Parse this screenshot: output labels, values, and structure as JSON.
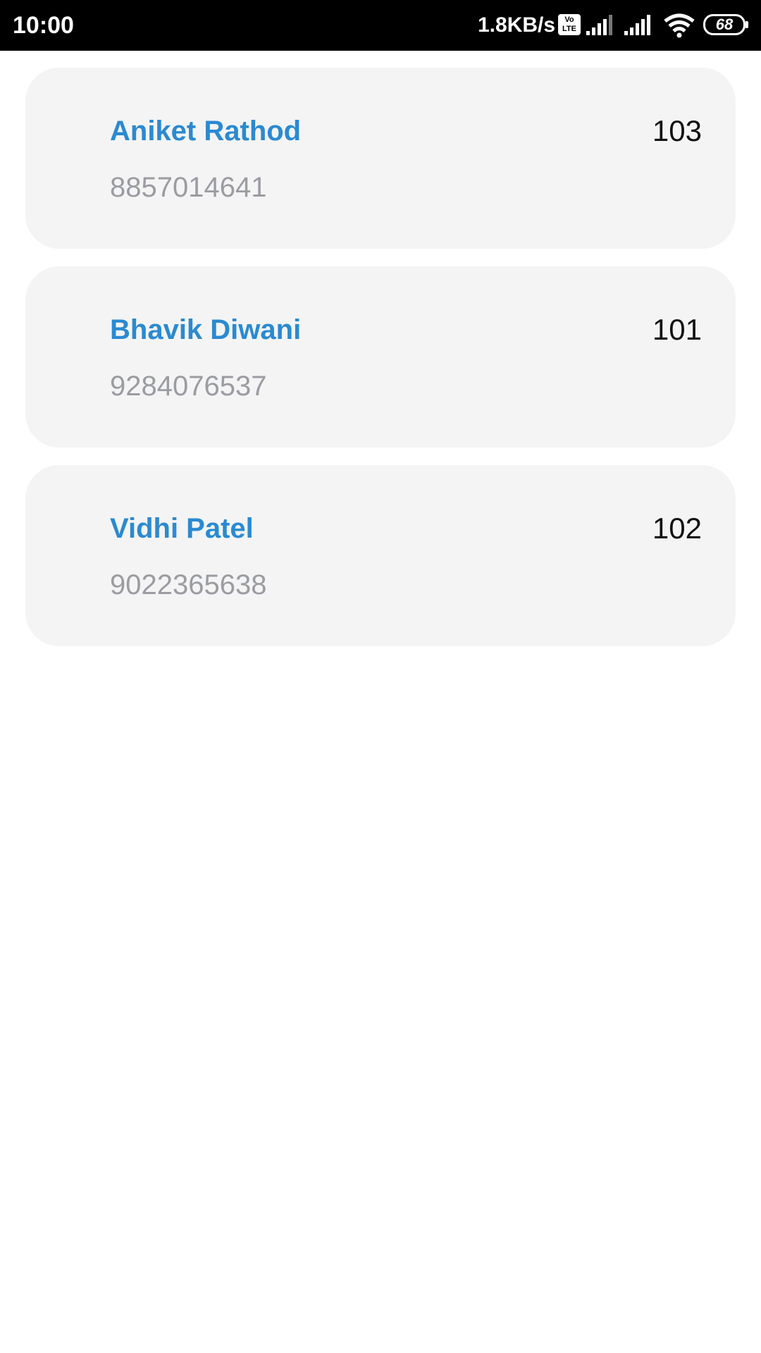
{
  "status_bar": {
    "time": "10:00",
    "network_speed": "1.8KB/s",
    "volte_label": "Vo LTE",
    "battery": "68"
  },
  "contacts": [
    {
      "name": "Aniket Rathod",
      "phone": "8857014641",
      "number": "103"
    },
    {
      "name": "Bhavik Diwani",
      "phone": "9284076537",
      "number": "101"
    },
    {
      "name": "Vidhi Patel",
      "phone": "9022365638",
      "number": "102"
    }
  ],
  "colors": {
    "name_accent": "#2a8ad1",
    "phone_gray": "#9b9ca1",
    "card_background": "#f4f4f5",
    "status_bar": "#000000"
  },
  "icons": [
    "volte-icon",
    "signal-icon",
    "signal-icon",
    "wifi-icon",
    "battery-icon"
  ]
}
